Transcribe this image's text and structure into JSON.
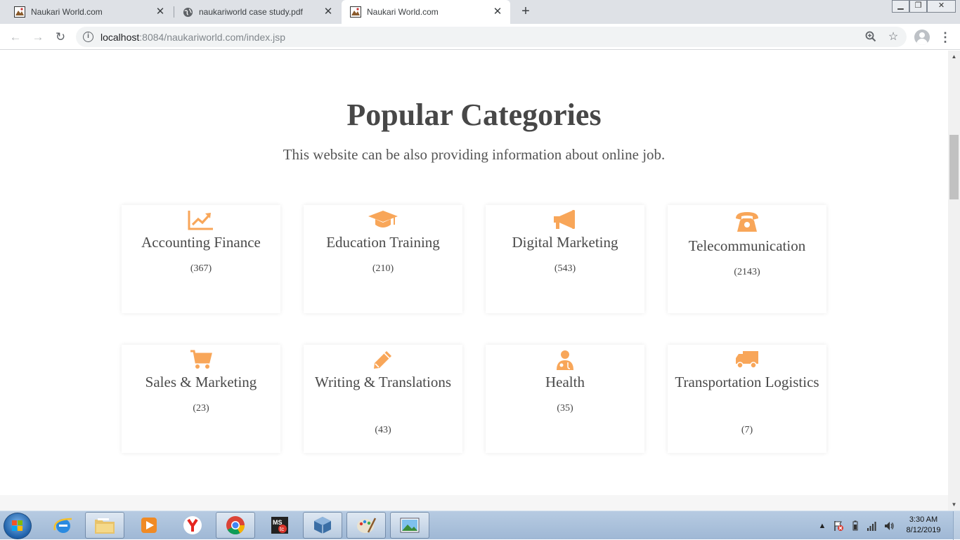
{
  "browser": {
    "tabs": [
      {
        "title": "Naukari World.com",
        "icon": "naukari-favicon",
        "active": false
      },
      {
        "title": "naukariworld case study.pdf",
        "icon": "globe-icon",
        "active": false
      },
      {
        "title": "Naukari World.com",
        "icon": "naukari-favicon",
        "active": true
      }
    ],
    "new_tab": "+",
    "url_host": "localhost",
    "url_rest": ":8084/naukariworld.com/index.jsp"
  },
  "page": {
    "title": "Popular Categories",
    "subtitle": "This website can be also providing information about online job.",
    "accent_color": "#f8a659",
    "categories": [
      {
        "name": "Accounting Finance",
        "count": "(367)",
        "icon": "chart-line-icon"
      },
      {
        "name": "Education Training",
        "count": "(210)",
        "icon": "graduation-cap-icon"
      },
      {
        "name": "Digital Marketing",
        "count": "(543)",
        "icon": "megaphone-icon"
      },
      {
        "name": "Telecommunication",
        "count": "(2143)",
        "icon": "phone-icon"
      },
      {
        "name": "Sales & Marketing",
        "count": "(23)",
        "icon": "cart-icon"
      },
      {
        "name": "Writing & Translations",
        "count": "(43)",
        "icon": "pencil-icon"
      },
      {
        "name": "Health",
        "count": "(35)",
        "icon": "doctor-icon"
      },
      {
        "name": "Transportation Logistics",
        "count": "(7)",
        "icon": "truck-icon"
      }
    ]
  },
  "taskbar": {
    "apps": [
      "internet-explorer-icon",
      "file-explorer-icon",
      "media-player-icon",
      "yandex-icon",
      "chrome-icon",
      "msaccess-icon",
      "virtualbox-icon",
      "paint-icon",
      "photo-viewer-icon"
    ],
    "time": "3:30 AM",
    "date": "8/12/2019"
  }
}
